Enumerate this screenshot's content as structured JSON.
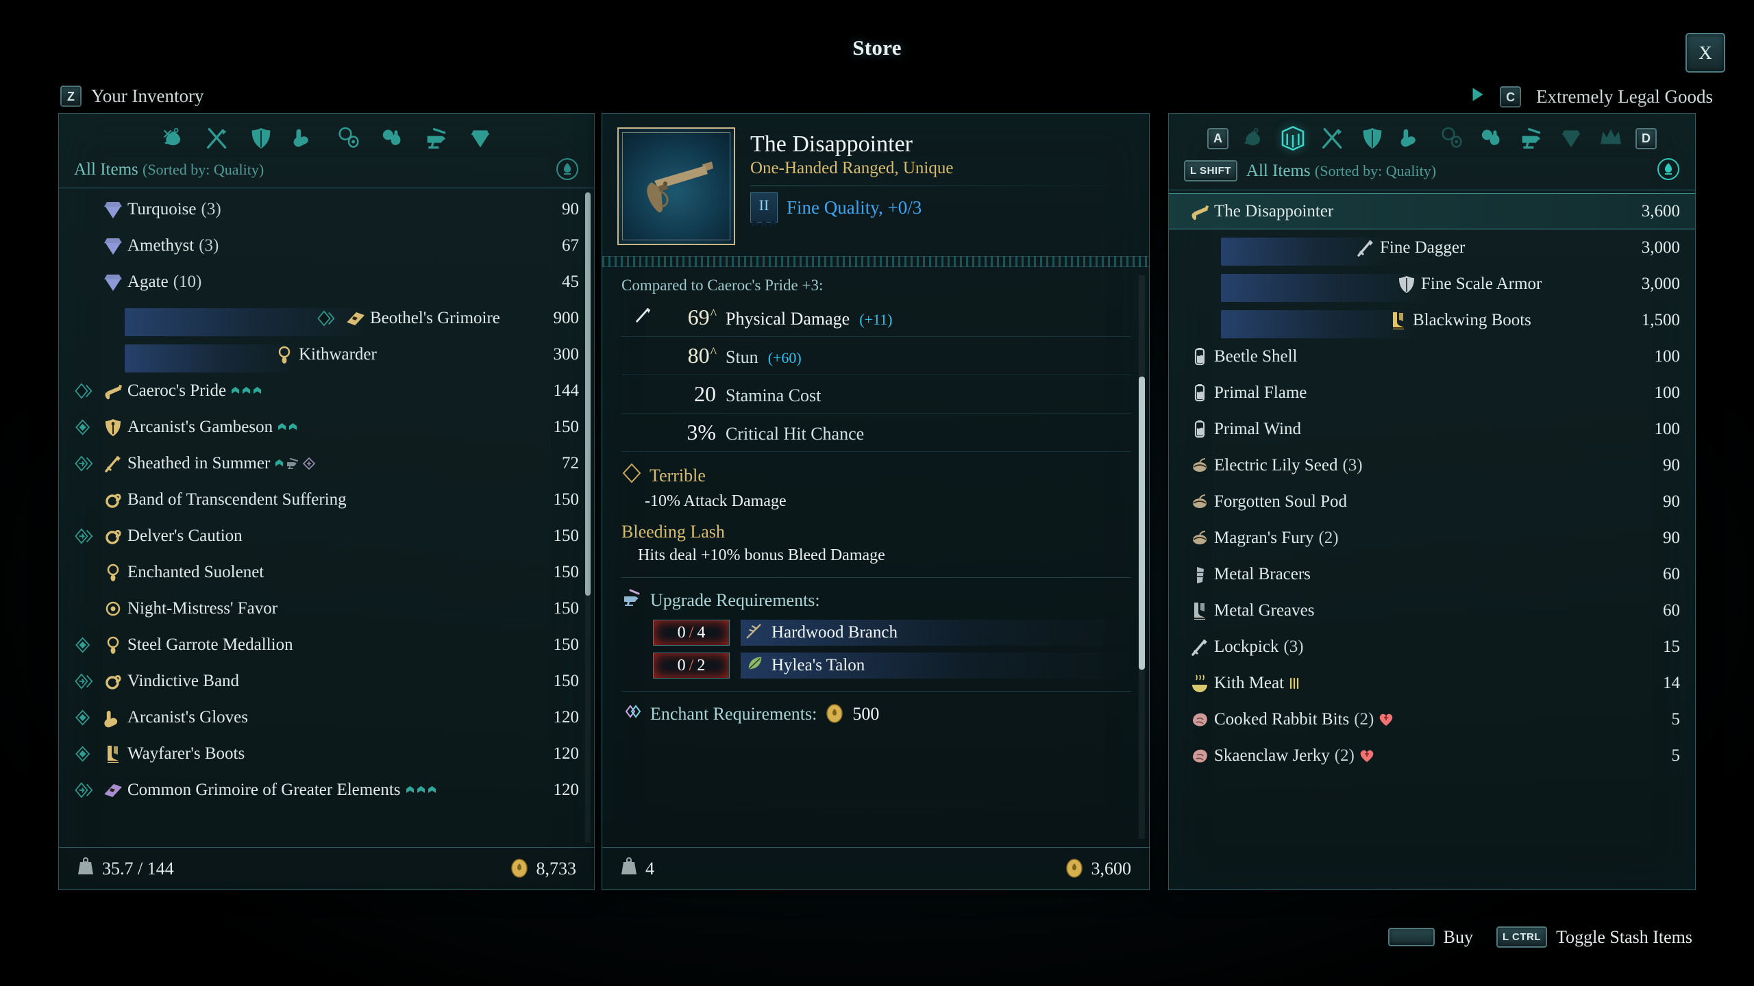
{
  "window": {
    "title": "Store",
    "close_label": "X"
  },
  "inventory": {
    "header_key": "Z",
    "header_label": "Your Inventory",
    "filter_label": "All Items",
    "filter_sorted": "(Sorted by: Quality)",
    "categories": [
      "loot-bag-icon",
      "weapons-icon",
      "armor-icon",
      "gloves-boots-icon",
      "jewelry-icon",
      "food-potion-icon",
      "anvil-icon",
      "gem-icon"
    ],
    "items": [
      {
        "name": "Turquoise",
        "qty": "(3)",
        "value": "90",
        "glyph": "gem-icon",
        "rarity": "",
        "color": "#8e9ad8",
        "marks": []
      },
      {
        "name": "Amethyst",
        "qty": "(3)",
        "value": "67",
        "glyph": "gem-icon",
        "rarity": "",
        "color": "#8e9ad8",
        "marks": []
      },
      {
        "name": "Agate",
        "qty": "(10)",
        "value": "45",
        "glyph": "gem-icon",
        "rarity": "",
        "color": "#8e9ad8",
        "marks": []
      },
      {
        "name": "Beothel's Grimoire",
        "qty": "",
        "value": "900",
        "glyph": "grimoire-icon",
        "rarity": "rare-diamond",
        "color": "#d9bd72",
        "marks": [],
        "highlight": true
      },
      {
        "name": "Kithwarder",
        "qty": "",
        "value": "300",
        "glyph": "amulet-icon",
        "rarity": "",
        "color": "#d9bd72",
        "marks": [],
        "highlight": true
      },
      {
        "name": "Caeroc's Pride",
        "qty": "",
        "value": "144",
        "glyph": "pistol-icon",
        "rarity": "rare-diamond",
        "color": "#d9bd72",
        "marks": [
          "chev",
          "chev",
          "chev"
        ]
      },
      {
        "name": "Arcanist's Gambeson",
        "qty": "",
        "value": "150",
        "glyph": "gambeson-icon",
        "rarity": "uncommon-diamond",
        "color": "#d9bd72",
        "marks": [
          "chev",
          "chev"
        ]
      },
      {
        "name": "Sheathed in Summer",
        "qty": "",
        "value": "72",
        "glyph": "dagger-icon",
        "rarity": "epic-diamond",
        "color": "#d9bd72",
        "marks": [
          "chev",
          "anvil",
          "enchant"
        ]
      },
      {
        "name": "Band of Transcendent Suffering",
        "qty": "",
        "value": "150",
        "glyph": "ring-icon",
        "rarity": "",
        "color": "#d9bd72",
        "marks": []
      },
      {
        "name": "Delver's Caution",
        "qty": "",
        "value": "150",
        "glyph": "ring-icon",
        "rarity": "epic-diamond",
        "color": "#d9bd72",
        "marks": []
      },
      {
        "name": "Enchanted Suolenet",
        "qty": "",
        "value": "150",
        "glyph": "amulet-icon",
        "rarity": "",
        "color": "#d9bd72",
        "marks": []
      },
      {
        "name": "Night-Mistress' Favor",
        "qty": "",
        "value": "150",
        "glyph": "charm-icon",
        "rarity": "",
        "color": "#d9bd72",
        "marks": []
      },
      {
        "name": "Steel Garrote Medallion",
        "qty": "",
        "value": "150",
        "glyph": "amulet-icon",
        "rarity": "uncommon-diamond",
        "color": "#d9bd72",
        "marks": []
      },
      {
        "name": "Vindictive Band",
        "qty": "",
        "value": "150",
        "glyph": "ring-icon",
        "rarity": "epic-diamond",
        "color": "#d9bd72",
        "marks": []
      },
      {
        "name": "Arcanist's Gloves",
        "qty": "",
        "value": "120",
        "glyph": "glove-icon",
        "rarity": "uncommon-diamond",
        "color": "#d9bd72",
        "marks": []
      },
      {
        "name": "Wayfarer's Boots",
        "qty": "",
        "value": "120",
        "glyph": "boots-icon",
        "rarity": "uncommon-diamond",
        "color": "#d9bd72",
        "marks": []
      },
      {
        "name": "Common Grimoire of Greater Elements",
        "qty": "",
        "value": "120",
        "glyph": "grimoire-icon",
        "rarity": "epic-diamond",
        "color": "#a98fd0",
        "marks": [
          "chev",
          "chev",
          "chev"
        ]
      }
    ],
    "footer_weight": "35.7 / 144",
    "footer_currency": "8,733"
  },
  "detail": {
    "title": "The Disappointer",
    "subtitle": "One-Handed Ranged, Unique",
    "tier": "II",
    "quality": "Fine Quality, +0/3",
    "compare_line": "Compared to Caeroc's Pride +3:",
    "stats": [
      {
        "value": "69",
        "caret": "^",
        "name": "Physical Damage",
        "delta": "(+11)",
        "icon": "sword-icon",
        "highlight": true
      },
      {
        "value": "80",
        "caret": "^",
        "name": "Stun",
        "delta": "(+60)",
        "icon": "",
        "highlight": false
      },
      {
        "value": "20",
        "caret": "",
        "name": "Stamina Cost",
        "delta": "",
        "icon": "",
        "highlight": false
      },
      {
        "value": "3%",
        "caret": "",
        "name": "Critical Hit Chance",
        "delta": "",
        "icon": "",
        "highlight": false
      }
    ],
    "traits": [
      {
        "name": "Terrible",
        "desc": "-10% Attack Damage",
        "icon": "diamond-icon"
      },
      {
        "name": "Bleeding Lash",
        "desc": "Hits deal +10% bonus Bleed Damage",
        "icon": ""
      }
    ],
    "upgrade_title": "Upgrade Requirements:",
    "upgrade_reqs": [
      {
        "have": "0",
        "need": "4",
        "name": "Hardwood Branch",
        "icon": "branch-icon"
      },
      {
        "have": "0",
        "need": "2",
        "name": "Hylea's Talon",
        "icon": "leaf-icon"
      }
    ],
    "enchant_title": "Enchant Requirements:",
    "enchant_cost": "500",
    "footer_count": "4",
    "footer_price": "3,600"
  },
  "store": {
    "header_key": "C",
    "header_label": "Extremely Legal Goods",
    "key_prev": "A",
    "key_next": "D",
    "key_filter": "L SHIFT",
    "filter_label": "All Items",
    "filter_sorted": "(Sorted by: Quality)",
    "categories": [
      "loot-bag-icon",
      "stash-icon",
      "weapons-icon",
      "armor-icon",
      "gloves-boots-icon",
      "jewelry-icon",
      "food-potion-icon",
      "anvil-icon",
      "gem-icon",
      "crown-icon"
    ],
    "items": [
      {
        "name": "The Disappointer",
        "qty": "",
        "value": "3,600",
        "glyph": "pistol-icon",
        "color": "#d9bd72",
        "selected": true
      },
      {
        "name": "Fine Dagger",
        "qty": "",
        "value": "3,000",
        "glyph": "dagger-icon",
        "color": "#c3cdd2",
        "highlight": true
      },
      {
        "name": "Fine Scale Armor",
        "qty": "",
        "value": "3,000",
        "glyph": "armor-icon",
        "color": "#c3cdd2",
        "highlight": true
      },
      {
        "name": "Blackwing Boots",
        "qty": "",
        "value": "1,500",
        "glyph": "boots-icon",
        "color": "#e3c45f",
        "highlight": true
      },
      {
        "name": "Beetle Shell",
        "qty": "",
        "value": "100",
        "glyph": "flask-icon",
        "color": "#c3cdd2"
      },
      {
        "name": "Primal Flame",
        "qty": "",
        "value": "100",
        "glyph": "flask-icon",
        "color": "#c3cdd2"
      },
      {
        "name": "Primal Wind",
        "qty": "",
        "value": "100",
        "glyph": "flask-icon",
        "color": "#c3cdd2"
      },
      {
        "name": "Electric Lily Seed",
        "qty": "(3)",
        "value": "90",
        "glyph": "seed-icon",
        "color": "#b9a98a"
      },
      {
        "name": "Forgotten Soul Pod",
        "qty": "",
        "value": "90",
        "glyph": "seed-icon",
        "color": "#b9a98a"
      },
      {
        "name": "Magran's Fury",
        "qty": "(2)",
        "value": "90",
        "glyph": "seed-icon",
        "color": "#b9a98a"
      },
      {
        "name": "Metal Bracers",
        "qty": "",
        "value": "60",
        "glyph": "bracer-icon",
        "color": "#b0bcc2"
      },
      {
        "name": "Metal Greaves",
        "qty": "",
        "value": "60",
        "glyph": "boots-icon",
        "color": "#b0bcc2"
      },
      {
        "name": "Lockpick",
        "qty": "(3)",
        "value": "15",
        "glyph": "dagger-icon",
        "color": "#c3cdd2"
      },
      {
        "name": "Kith Meat",
        "qty": "",
        "value": "14",
        "glyph": "meal-icon",
        "color": "#d9c96e",
        "marks": [
          "food"
        ]
      },
      {
        "name": "Cooked Rabbit Bits",
        "qty": "(2)",
        "value": "5",
        "glyph": "steak-icon",
        "color": "#cf9b98",
        "marks": [
          "heart"
        ]
      },
      {
        "name": "Skaenclaw Jerky",
        "qty": "(2)",
        "value": "5",
        "glyph": "steak-icon",
        "color": "#cf9b98",
        "marks": [
          "heart"
        ]
      }
    ]
  },
  "hints": [
    {
      "key": "",
      "key_type": "space",
      "label": "Buy"
    },
    {
      "key": "L CTRL",
      "key_type": "wide",
      "label": "Toggle Stash Items"
    }
  ]
}
